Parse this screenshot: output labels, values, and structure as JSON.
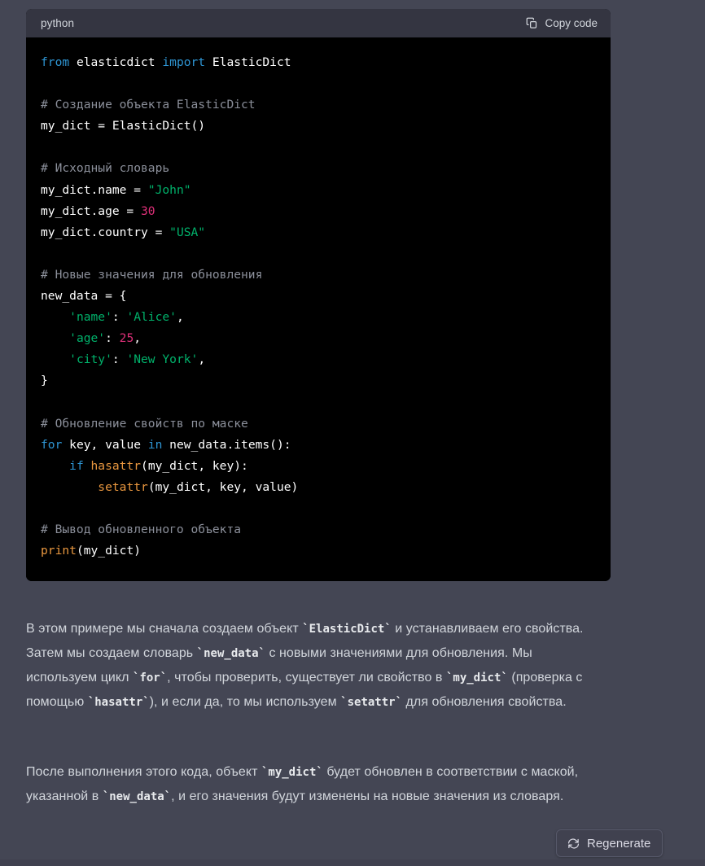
{
  "theme": {
    "page_bg": "#444654",
    "code_header_bg": "#343541",
    "code_body_bg": "#000000",
    "text_color": "#d1d5db",
    "keyword_color": "#2e95d3",
    "function_color": "#e9973f",
    "string_color": "#00b26b",
    "number_color": "#df3079",
    "comment_color": "#8b8f9a",
    "button_bg": "#40414f",
    "button_border": "#565869"
  },
  "code_block": {
    "language_label": "python",
    "copy_label": "Copy code",
    "copy_icon": "clipboard-icon",
    "lines": [
      [
        {
          "t": "from ",
          "c": "k"
        },
        {
          "t": "elasticdict ",
          "c": "pl"
        },
        {
          "t": "import ",
          "c": "k"
        },
        {
          "t": "ElasticDict",
          "c": "pl"
        }
      ],
      [],
      [
        {
          "t": "# Создание объекта ElasticDict",
          "c": "cm"
        }
      ],
      [
        {
          "t": "my_dict = ElasticDict()",
          "c": "pl"
        }
      ],
      [],
      [
        {
          "t": "# Исходный словарь",
          "c": "cm"
        }
      ],
      [
        {
          "t": "my_dict.name = ",
          "c": "pl"
        },
        {
          "t": "\"John\"",
          "c": "st"
        }
      ],
      [
        {
          "t": "my_dict.age = ",
          "c": "pl"
        },
        {
          "t": "30",
          "c": "nm"
        }
      ],
      [
        {
          "t": "my_dict.country = ",
          "c": "pl"
        },
        {
          "t": "\"USA\"",
          "c": "st"
        }
      ],
      [],
      [
        {
          "t": "# Новые значения для обновления",
          "c": "cm"
        }
      ],
      [
        {
          "t": "new_data = {",
          "c": "pl"
        }
      ],
      [
        {
          "t": "    ",
          "c": "pl"
        },
        {
          "t": "'name'",
          "c": "st"
        },
        {
          "t": ": ",
          "c": "pl"
        },
        {
          "t": "'Alice'",
          "c": "st"
        },
        {
          "t": ",",
          "c": "pl"
        }
      ],
      [
        {
          "t": "    ",
          "c": "pl"
        },
        {
          "t": "'age'",
          "c": "st"
        },
        {
          "t": ": ",
          "c": "pl"
        },
        {
          "t": "25",
          "c": "nm"
        },
        {
          "t": ",",
          "c": "pl"
        }
      ],
      [
        {
          "t": "    ",
          "c": "pl"
        },
        {
          "t": "'city'",
          "c": "st"
        },
        {
          "t": ": ",
          "c": "pl"
        },
        {
          "t": "'New York'",
          "c": "st"
        },
        {
          "t": ",",
          "c": "pl"
        }
      ],
      [
        {
          "t": "}",
          "c": "pl"
        }
      ],
      [],
      [
        {
          "t": "# Обновление свойств по маске",
          "c": "cm"
        }
      ],
      [
        {
          "t": "for ",
          "c": "k"
        },
        {
          "t": "key, value ",
          "c": "pl"
        },
        {
          "t": "in ",
          "c": "k"
        },
        {
          "t": "new_data.items():",
          "c": "pl"
        }
      ],
      [
        {
          "t": "    ",
          "c": "pl"
        },
        {
          "t": "if ",
          "c": "k"
        },
        {
          "t": "hasattr",
          "c": "fn"
        },
        {
          "t": "(my_dict, key):",
          "c": "pl"
        }
      ],
      [
        {
          "t": "        ",
          "c": "pl"
        },
        {
          "t": "setattr",
          "c": "fn"
        },
        {
          "t": "(my_dict, key, value)",
          "c": "pl"
        }
      ],
      [],
      [
        {
          "t": "# Вывод обновленного объекта",
          "c": "cm"
        }
      ],
      [
        {
          "t": "print",
          "c": "fn"
        },
        {
          "t": "(my_dict)",
          "c": "pl"
        }
      ]
    ]
  },
  "prose": {
    "paragraph_1": [
      {
        "t": "В этом примере мы сначала создаем объект ",
        "code": false
      },
      {
        "t": "`ElasticDict`",
        "code": true
      },
      {
        "t": " и устанавливаем его свойства. Затем мы создаем словарь ",
        "code": false
      },
      {
        "t": "`new_data`",
        "code": true
      },
      {
        "t": " с новыми значениями для обновления. Мы используем цикл ",
        "code": false
      },
      {
        "t": "`for`",
        "code": true
      },
      {
        "t": ", чтобы проверить, существует ли свойство в ",
        "code": false
      },
      {
        "t": "`my_dict`",
        "code": true
      },
      {
        "t": " (проверка с помощью ",
        "code": false
      },
      {
        "t": "`hasattr`",
        "code": true
      },
      {
        "t": "), и если да, то мы используем ",
        "code": false
      },
      {
        "t": "`setattr`",
        "code": true
      },
      {
        "t": " для обновления свойства.",
        "code": false
      }
    ],
    "paragraph_2": [
      {
        "t": "После выполнения этого кода, объект ",
        "code": false
      },
      {
        "t": "`my_dict`",
        "code": true
      },
      {
        "t": " будет обновлен в соответствии с маской, указанной в ",
        "code": false
      },
      {
        "t": "`new_data`",
        "code": true
      },
      {
        "t": ", и его значения будут изменены на новые значения из словаря.",
        "code": false
      }
    ]
  },
  "regenerate": {
    "label": "Regenerate",
    "icon": "refresh-icon"
  }
}
